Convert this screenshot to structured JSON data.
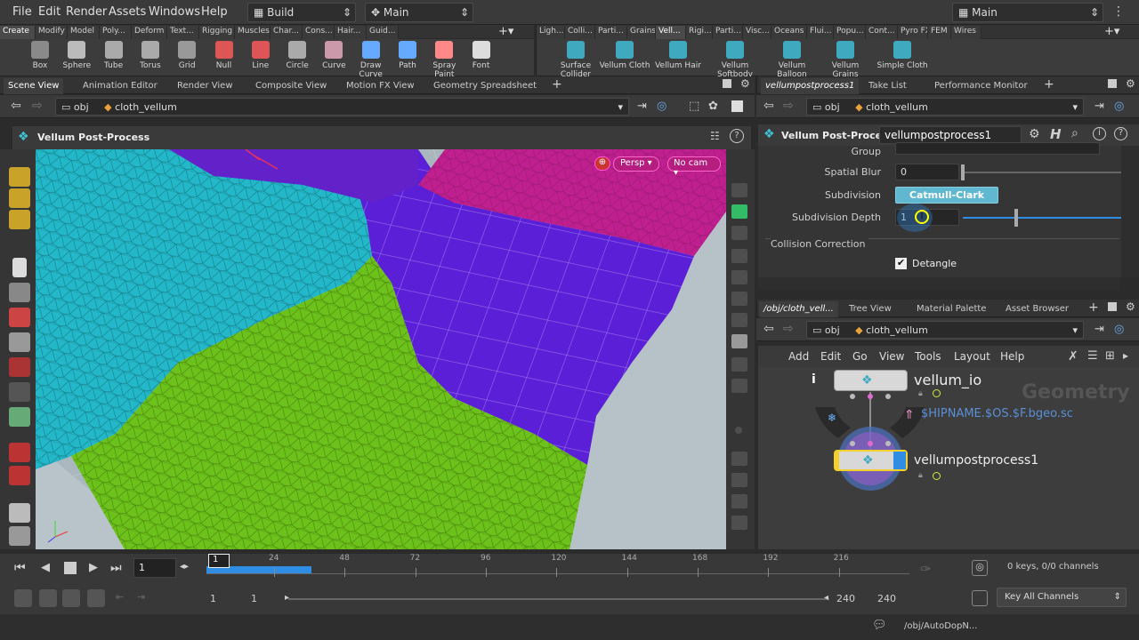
{
  "menu": {
    "items": [
      "File",
      "Edit",
      "Render",
      "Assets",
      "Windows",
      "Help"
    ],
    "desktop": "Build",
    "context": "Main",
    "right_desktop": "Main"
  },
  "shelf_left": {
    "tabs": [
      "Create",
      "Modify",
      "Model",
      "Poly...",
      "Deform",
      "Text...",
      "Rigging",
      "Muscles",
      "Char...",
      "Cons...",
      "Hair...",
      "Guid..."
    ],
    "tools": [
      "Box",
      "Sphere",
      "Tube",
      "Torus",
      "Grid",
      "Null",
      "Line",
      "Circle",
      "Curve",
      "Draw Curve",
      "Path",
      "Spray Paint",
      "Font"
    ]
  },
  "shelf_right": {
    "tabs": [
      "Ligh...",
      "Colli...",
      "Parti...",
      "Grains",
      "Vell...",
      "Rigi...",
      "Parti...",
      "Visc...",
      "Oceans",
      "Flui...",
      "Popu...",
      "Cont...",
      "Pyro FX",
      "FEM",
      "Wires"
    ],
    "tools": [
      {
        "a": "Surface",
        "b": "Collider"
      },
      {
        "a": "Vellum Cloth",
        "b": ""
      },
      {
        "a": "Vellum Hair",
        "b": ""
      },
      {
        "a": "Vellum",
        "b": "Softbody"
      },
      {
        "a": "Vellum",
        "b": "Balloon"
      },
      {
        "a": "Vellum Grains",
        "b": ""
      },
      {
        "a": "Simple Cloth",
        "b": ""
      }
    ]
  },
  "viewer": {
    "tabs": [
      "Scene View",
      "Animation Editor",
      "Render View",
      "Composite View",
      "Motion FX View",
      "Geometry Spreadsheet"
    ],
    "path_obj": "obj",
    "path_node": "cloth_vellum",
    "title": "Vellum Post-Process",
    "persp": "Persp",
    "cam": "No cam"
  },
  "params": {
    "tabs": [
      "vellumpostprocess1",
      "Take List",
      "Performance Monitor"
    ],
    "path_obj": "obj",
    "path_node": "cloth_vellum",
    "node_type": "Vellum Post-Process",
    "node_name": "vellumpostprocess1",
    "group_label": "Group",
    "spatial_blur_label": "Spatial Blur",
    "spatial_blur_value": "0",
    "subdivision_label": "Subdivision",
    "subdivision_value": "Catmull-Clark",
    "subdiv_depth_label": "Subdivision Depth",
    "subdiv_depth_value": "1",
    "collision_section": "Collision Correction",
    "detangle_label": "Detangle"
  },
  "network": {
    "tabs": [
      "/obj/cloth_vell...",
      "Tree View",
      "Material Palette",
      "Asset Browser"
    ],
    "path_obj": "obj",
    "path_node": "cloth_vellum",
    "menu": [
      "Add",
      "Edit",
      "Go",
      "View",
      "Tools",
      "Layout",
      "Help"
    ],
    "watermark": "Geometry",
    "node1": "vellum_io",
    "node1_sub": "$HIPNAME.$OS.$F.bgeo.sc",
    "node2": "vellumpostprocess1",
    "info": "i"
  },
  "timeline": {
    "frame": "1",
    "current_tick": "1",
    "ticks": [
      "24",
      "48",
      "72",
      "96",
      "120",
      "144",
      "168",
      "192",
      "216"
    ],
    "start": "1",
    "start2": "1",
    "end": "240",
    "end2": "240",
    "keys": "0 keys, 0/0 channels",
    "key_all": "Key All Channels",
    "status_path": "/obj/AutoDopN..."
  },
  "colors": {
    "cyan": "#23b8c9",
    "purple": "#5b1fd8",
    "magenta": "#c0208f",
    "green": "#6cc21a",
    "accent": "#2f8de4"
  }
}
